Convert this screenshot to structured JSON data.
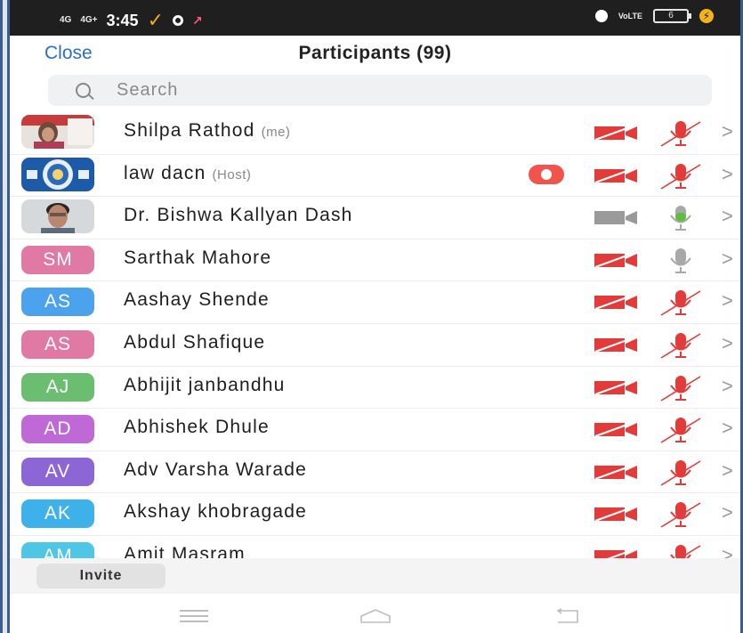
{
  "status_bar": {
    "signal_1": "4G",
    "signal_2": "4G+",
    "time": "3:45",
    "volte": "VoLTE",
    "battery": "6"
  },
  "header": {
    "close_label": "Close",
    "title": "Participants (99)"
  },
  "search": {
    "placeholder": "Search"
  },
  "participants": [
    {
      "name": "Shilpa Rathod",
      "tag": "(me)",
      "avatar": "photo",
      "video": "off",
      "mic": "muted"
    },
    {
      "name": "law dacn",
      "tag": "(Host)",
      "avatar": "logo",
      "recording": true,
      "video": "off",
      "mic": "muted"
    },
    {
      "name": "Dr. Bishwa Kallyan Dash",
      "tag": "",
      "avatar": "photo",
      "video": "available",
      "mic": "active"
    },
    {
      "name": "Sarthak Mahore",
      "tag": "",
      "initials": "SM",
      "color": "#e07aa4",
      "video": "off",
      "mic": "available"
    },
    {
      "name": "Aashay Shende",
      "tag": "",
      "initials": "AS",
      "color": "#4da2ee",
      "video": "off",
      "mic": "muted"
    },
    {
      "name": "Abdul Shafique",
      "tag": "",
      "initials": "AS",
      "color": "#e07aa4",
      "video": "off",
      "mic": "muted"
    },
    {
      "name": "Abhijit janbandhu",
      "tag": "",
      "initials": "AJ",
      "color": "#6bbd6f",
      "video": "off",
      "mic": "muted"
    },
    {
      "name": "Abhishek Dhule",
      "tag": "",
      "initials": "AD",
      "color": "#bf69d6",
      "video": "off",
      "mic": "muted"
    },
    {
      "name": "Adv Varsha Warade",
      "tag": "",
      "initials": "AV",
      "color": "#8c66d4",
      "video": "off",
      "mic": "muted"
    },
    {
      "name": "Akshay khobragade",
      "tag": "",
      "initials": "AK",
      "color": "#3fb1ea",
      "video": "off",
      "mic": "muted"
    },
    {
      "name": "Amit Masram",
      "tag": "",
      "initials": "AM",
      "color": "#4fc6e6",
      "video": "off",
      "mic": "muted"
    }
  ],
  "footer": {
    "invite_label": "Invite"
  },
  "colors": {
    "accent_blue": "#2d6ec5",
    "muted_red": "#e33a3a",
    "active_green": "#5bbf3b",
    "recording_red": "#f0544a"
  }
}
